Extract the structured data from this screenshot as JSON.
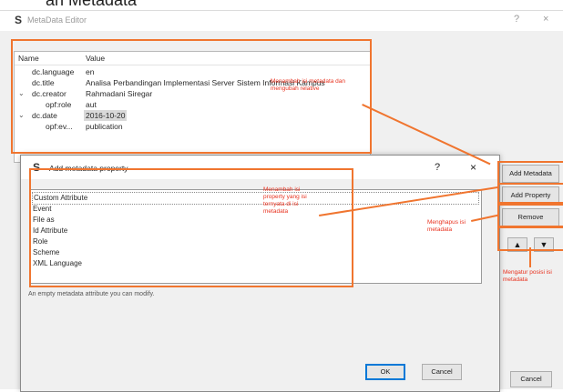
{
  "caption": "an Metadata",
  "window": {
    "title": "MetaData Editor",
    "help": "?",
    "close": "×"
  },
  "tree": {
    "headers": {
      "name": "Name",
      "value": "Value"
    },
    "rows": [
      {
        "name": "dc.language",
        "value": "en"
      },
      {
        "name": "dc.title",
        "value": "Analisa Perbandingan Implementasi Server Sistem Informasi Kampus"
      },
      {
        "name": "dc.creator",
        "value": "Rahmadani Siregar"
      },
      {
        "name": "opf:role",
        "value": "aut"
      },
      {
        "name": "dc.date",
        "value": "2016-10-20"
      },
      {
        "name": "opf:ev...",
        "value": "publication"
      }
    ]
  },
  "buttons": {
    "add_metadata": "Add Metadata",
    "add_property": "Add Property",
    "remove": "Remove",
    "move_up": "▲",
    "move_down": "▼",
    "cancel": "Cancel"
  },
  "dialog": {
    "title": "Add metadata property",
    "help": "?",
    "close": "×",
    "items": [
      "Custom Attribute",
      "Event",
      "File as",
      "Id Attribute",
      "Role",
      "Scheme",
      "XML Language"
    ],
    "selected_item": "Custom Attribute",
    "hint": "An empty metadata attribute you can modify.",
    "ok": "OK",
    "cancel": "Cancel"
  },
  "annotations": {
    "tree_note": "Menambah isi metadata dan mengubah relative",
    "list_note": "Menambah isi property yang isi ternyata di isi metadata",
    "remove_note": "Menghapus isi metadata",
    "move_note": "Mengatur posisi isi metadata"
  },
  "colors": {
    "annotation": "#f0752f",
    "annotation_text": "#e8321f",
    "selection": "#d9d9d9",
    "ok_focus": "#0078d7"
  }
}
